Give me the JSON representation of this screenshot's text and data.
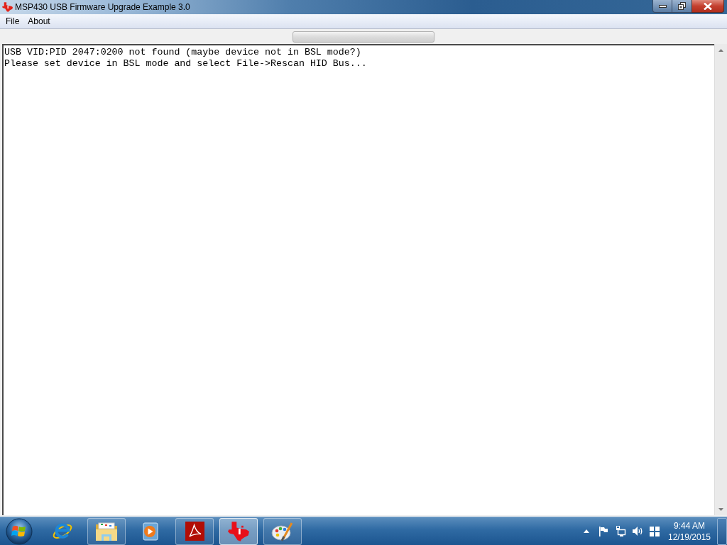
{
  "window": {
    "title": "MSP430 USB Firmware Upgrade Example 3.0"
  },
  "menu": [
    {
      "label": "File"
    },
    {
      "label": "About"
    }
  ],
  "progress": {
    "level": 0
  },
  "log": {
    "lines": [
      "USB VID:PID 2047:0200 not found (maybe device not in BSL mode?)",
      "Please set device in BSL mode and select File->Rescan HID Bus..."
    ]
  },
  "taskbar": {
    "items": [
      {
        "kind": "browser",
        "running": false,
        "selected": false
      },
      {
        "kind": "folder",
        "running": true,
        "selected": false
      },
      {
        "kind": "media",
        "running": false,
        "selected": false
      },
      {
        "kind": "pdf",
        "running": true,
        "selected": false
      },
      {
        "kind": "texas",
        "running": true,
        "selected": true
      },
      {
        "kind": "paint",
        "running": true,
        "selected": false
      }
    ]
  },
  "tray": {
    "time": "9:44 AM",
    "date": "12/19/2015"
  }
}
